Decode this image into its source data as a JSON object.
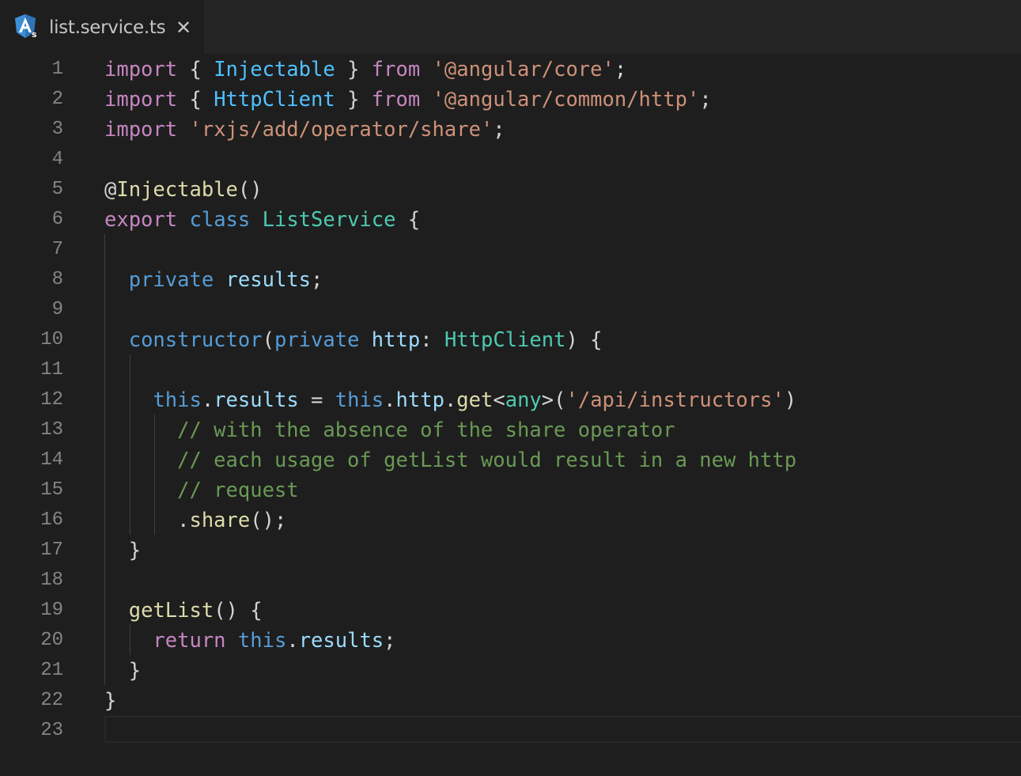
{
  "tab": {
    "title": "list.service.ts",
    "close": "✕",
    "icon": "angular-icon"
  },
  "lines": [
    {
      "num": "1",
      "tokens": [
        {
          "t": "import",
          "c": "kw"
        },
        {
          "t": " { ",
          "c": "pl"
        },
        {
          "t": "Injectable",
          "c": "st"
        },
        {
          "t": " } ",
          "c": "pl"
        },
        {
          "t": "from",
          "c": "kw"
        },
        {
          "t": " ",
          "c": "pl"
        },
        {
          "t": "'@angular/core'",
          "c": "str"
        },
        {
          "t": ";",
          "c": "pl"
        }
      ]
    },
    {
      "num": "2",
      "tokens": [
        {
          "t": "import",
          "c": "kw"
        },
        {
          "t": " { ",
          "c": "pl"
        },
        {
          "t": "HttpClient",
          "c": "st"
        },
        {
          "t": " } ",
          "c": "pl"
        },
        {
          "t": "from",
          "c": "kw"
        },
        {
          "t": " ",
          "c": "pl"
        },
        {
          "t": "'@angular/common/http'",
          "c": "str"
        },
        {
          "t": ";",
          "c": "pl"
        }
      ]
    },
    {
      "num": "3",
      "tokens": [
        {
          "t": "import",
          "c": "kw"
        },
        {
          "t": " ",
          "c": "pl"
        },
        {
          "t": "'rxjs/add/operator/share'",
          "c": "str"
        },
        {
          "t": ";",
          "c": "pl"
        }
      ]
    },
    {
      "num": "4",
      "tokens": []
    },
    {
      "num": "5",
      "tokens": [
        {
          "t": "@",
          "c": "pl"
        },
        {
          "t": "Injectable",
          "c": "fn"
        },
        {
          "t": "()",
          "c": "pl"
        }
      ]
    },
    {
      "num": "6",
      "tokens": [
        {
          "t": "export",
          "c": "kw"
        },
        {
          "t": " ",
          "c": "pl"
        },
        {
          "t": "class",
          "c": "pr"
        },
        {
          "t": " ",
          "c": "pl"
        },
        {
          "t": "ListService",
          "c": "ty"
        },
        {
          "t": " {",
          "c": "pl"
        }
      ]
    },
    {
      "num": "7",
      "tokens": []
    },
    {
      "num": "8",
      "tokens": [
        {
          "t": "  ",
          "c": "pl"
        },
        {
          "t": "private",
          "c": "pr"
        },
        {
          "t": " ",
          "c": "pl"
        },
        {
          "t": "results",
          "c": "vr"
        },
        {
          "t": ";",
          "c": "pl"
        }
      ]
    },
    {
      "num": "9",
      "tokens": []
    },
    {
      "num": "10",
      "tokens": [
        {
          "t": "  ",
          "c": "pl"
        },
        {
          "t": "constructor",
          "c": "pr"
        },
        {
          "t": "(",
          "c": "pl"
        },
        {
          "t": "private",
          "c": "pr"
        },
        {
          "t": " ",
          "c": "pl"
        },
        {
          "t": "http",
          "c": "vr"
        },
        {
          "t": ": ",
          "c": "pl"
        },
        {
          "t": "HttpClient",
          "c": "ty"
        },
        {
          "t": ") {",
          "c": "pl"
        }
      ]
    },
    {
      "num": "11",
      "tokens": []
    },
    {
      "num": "12",
      "tokens": [
        {
          "t": "    ",
          "c": "pl"
        },
        {
          "t": "this",
          "c": "pr"
        },
        {
          "t": ".",
          "c": "pl"
        },
        {
          "t": "results",
          "c": "vr"
        },
        {
          "t": " = ",
          "c": "pl"
        },
        {
          "t": "this",
          "c": "pr"
        },
        {
          "t": ".",
          "c": "pl"
        },
        {
          "t": "http",
          "c": "vr"
        },
        {
          "t": ".",
          "c": "pl"
        },
        {
          "t": "get",
          "c": "fn"
        },
        {
          "t": "<",
          "c": "pl"
        },
        {
          "t": "any",
          "c": "ty"
        },
        {
          "t": ">(",
          "c": "pl"
        },
        {
          "t": "'/api/instructors'",
          "c": "str"
        },
        {
          "t": ")",
          "c": "pl"
        }
      ]
    },
    {
      "num": "13",
      "tokens": [
        {
          "t": "      ",
          "c": "pl"
        },
        {
          "t": "// with the absence of the share operator",
          "c": "cm"
        }
      ]
    },
    {
      "num": "14",
      "tokens": [
        {
          "t": "      ",
          "c": "pl"
        },
        {
          "t": "// each usage of getList would result in a new http",
          "c": "cm"
        }
      ]
    },
    {
      "num": "15",
      "tokens": [
        {
          "t": "      ",
          "c": "pl"
        },
        {
          "t": "// request",
          "c": "cm"
        }
      ]
    },
    {
      "num": "16",
      "tokens": [
        {
          "t": "      .",
          "c": "pl"
        },
        {
          "t": "share",
          "c": "fn"
        },
        {
          "t": "();",
          "c": "pl"
        }
      ]
    },
    {
      "num": "17",
      "tokens": [
        {
          "t": "  }",
          "c": "pl"
        }
      ]
    },
    {
      "num": "18",
      "tokens": []
    },
    {
      "num": "19",
      "tokens": [
        {
          "t": "  ",
          "c": "pl"
        },
        {
          "t": "getList",
          "c": "fn"
        },
        {
          "t": "() {",
          "c": "pl"
        }
      ]
    },
    {
      "num": "20",
      "tokens": [
        {
          "t": "    ",
          "c": "pl"
        },
        {
          "t": "return",
          "c": "kw"
        },
        {
          "t": " ",
          "c": "pl"
        },
        {
          "t": "this",
          "c": "pr"
        },
        {
          "t": ".",
          "c": "pl"
        },
        {
          "t": "results",
          "c": "vr"
        },
        {
          "t": ";",
          "c": "pl"
        }
      ]
    },
    {
      "num": "21",
      "tokens": [
        {
          "t": "  }",
          "c": "pl"
        }
      ]
    },
    {
      "num": "22",
      "tokens": [
        {
          "t": "}",
          "c": "pl"
        }
      ]
    },
    {
      "num": "23",
      "tokens": []
    }
  ]
}
